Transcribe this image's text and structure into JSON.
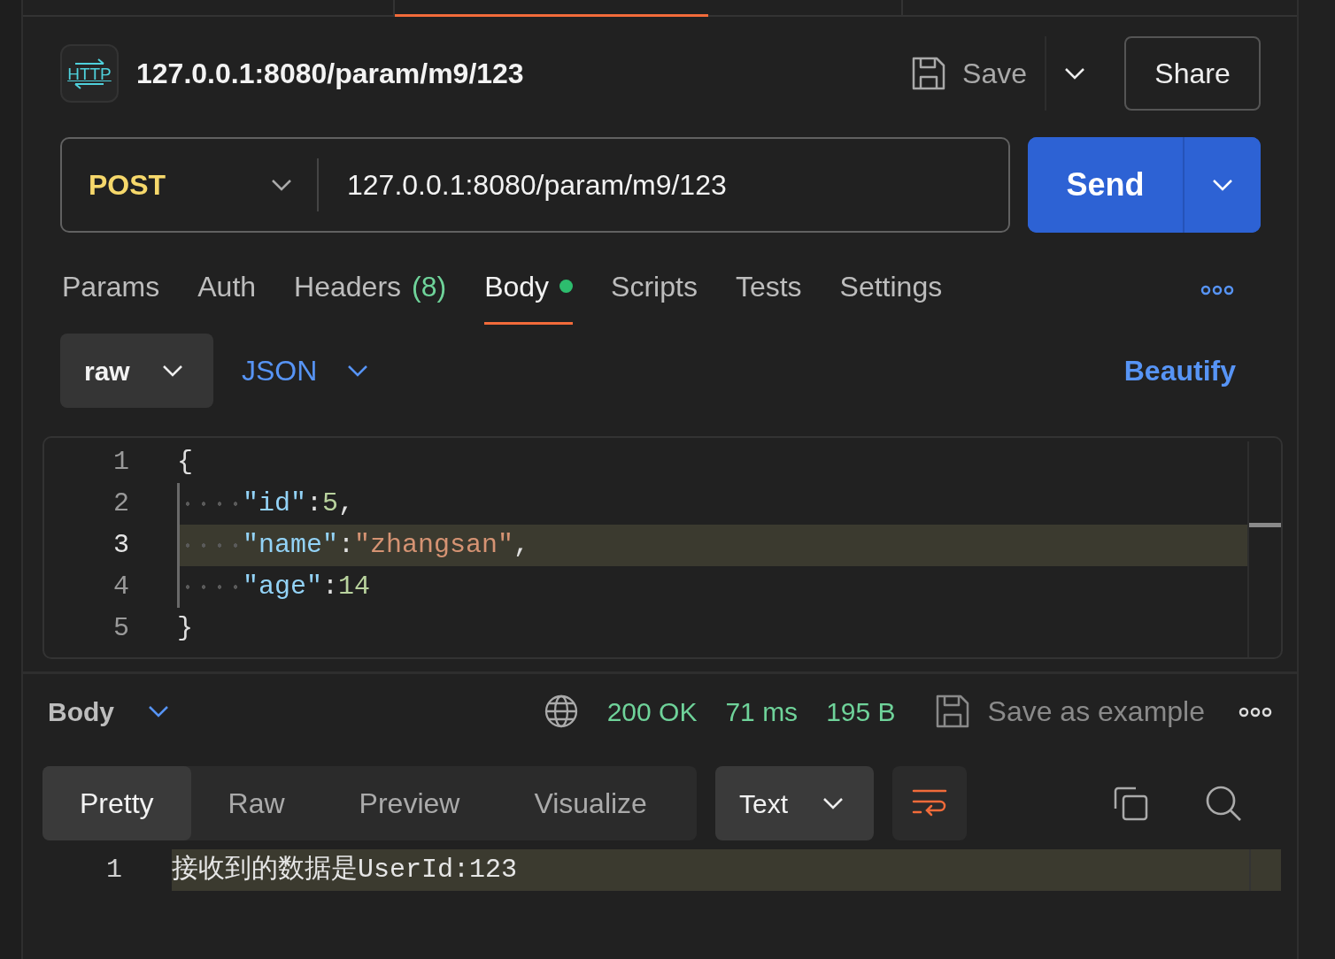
{
  "tab_strip": [
    {
      "selected": false
    },
    {
      "selected": true
    },
    {
      "selected": false
    }
  ],
  "request": {
    "badge": "HTTP",
    "title": "127.0.0.1:8080/param/m9/123",
    "save_label": "Save",
    "share_label": "Share"
  },
  "url_bar": {
    "method": "POST",
    "url": "127.0.0.1:8080/param/m9/123",
    "send_label": "Send"
  },
  "tabs": [
    {
      "label": "Params",
      "selected": false,
      "modified": false
    },
    {
      "label": "Auth",
      "selected": false,
      "modified": false
    },
    {
      "label": "Headers",
      "count": "(8)",
      "selected": false,
      "modified": false
    },
    {
      "label": "Body",
      "selected": true,
      "modified": true
    },
    {
      "label": "Scripts",
      "selected": false,
      "modified": false
    },
    {
      "label": "Tests",
      "selected": false,
      "modified": false
    },
    {
      "label": "Settings",
      "selected": false,
      "modified": false
    }
  ],
  "body_options": {
    "mode": "raw",
    "language": "JSON",
    "beautify_label": "Beautify"
  },
  "editor": {
    "lines": [
      {
        "number": "1",
        "indented": false,
        "highlighted": false,
        "tokens": [
          {
            "kind": "punct",
            "text": "{"
          }
        ]
      },
      {
        "number": "2",
        "indented": true,
        "highlighted": false,
        "tokens": [
          {
            "kind": "key",
            "text": "\"id\""
          },
          {
            "kind": "punct",
            "text": ":"
          },
          {
            "kind": "number",
            "text": "5"
          },
          {
            "kind": "punct",
            "text": ","
          }
        ]
      },
      {
        "number": "3",
        "indented": true,
        "highlighted": true,
        "tokens": [
          {
            "kind": "key",
            "text": "\"name\""
          },
          {
            "kind": "punct",
            "text": ":"
          },
          {
            "kind": "string",
            "text": "\"zhangsan\""
          },
          {
            "kind": "punct",
            "text": ","
          }
        ]
      },
      {
        "number": "4",
        "indented": true,
        "highlighted": false,
        "tokens": [
          {
            "kind": "key",
            "text": "\"age\""
          },
          {
            "kind": "punct",
            "text": ":"
          },
          {
            "kind": "number",
            "text": "14"
          }
        ]
      },
      {
        "number": "5",
        "indented": false,
        "highlighted": false,
        "tokens": [
          {
            "kind": "punct",
            "text": "}"
          }
        ]
      }
    ]
  },
  "response": {
    "section_label": "Body",
    "status": "200 OK",
    "time": "71 ms",
    "size": "195 B",
    "save_example_label": "Save as example",
    "view_tabs": [
      {
        "label": "Pretty",
        "selected": true
      },
      {
        "label": "Raw",
        "selected": false
      },
      {
        "label": "Preview",
        "selected": false
      },
      {
        "label": "Visualize",
        "selected": false
      }
    ],
    "format": "Text",
    "lines": [
      {
        "number": "1",
        "text": "接收到的数据是UserId:123",
        "highlighted": true
      }
    ]
  }
}
